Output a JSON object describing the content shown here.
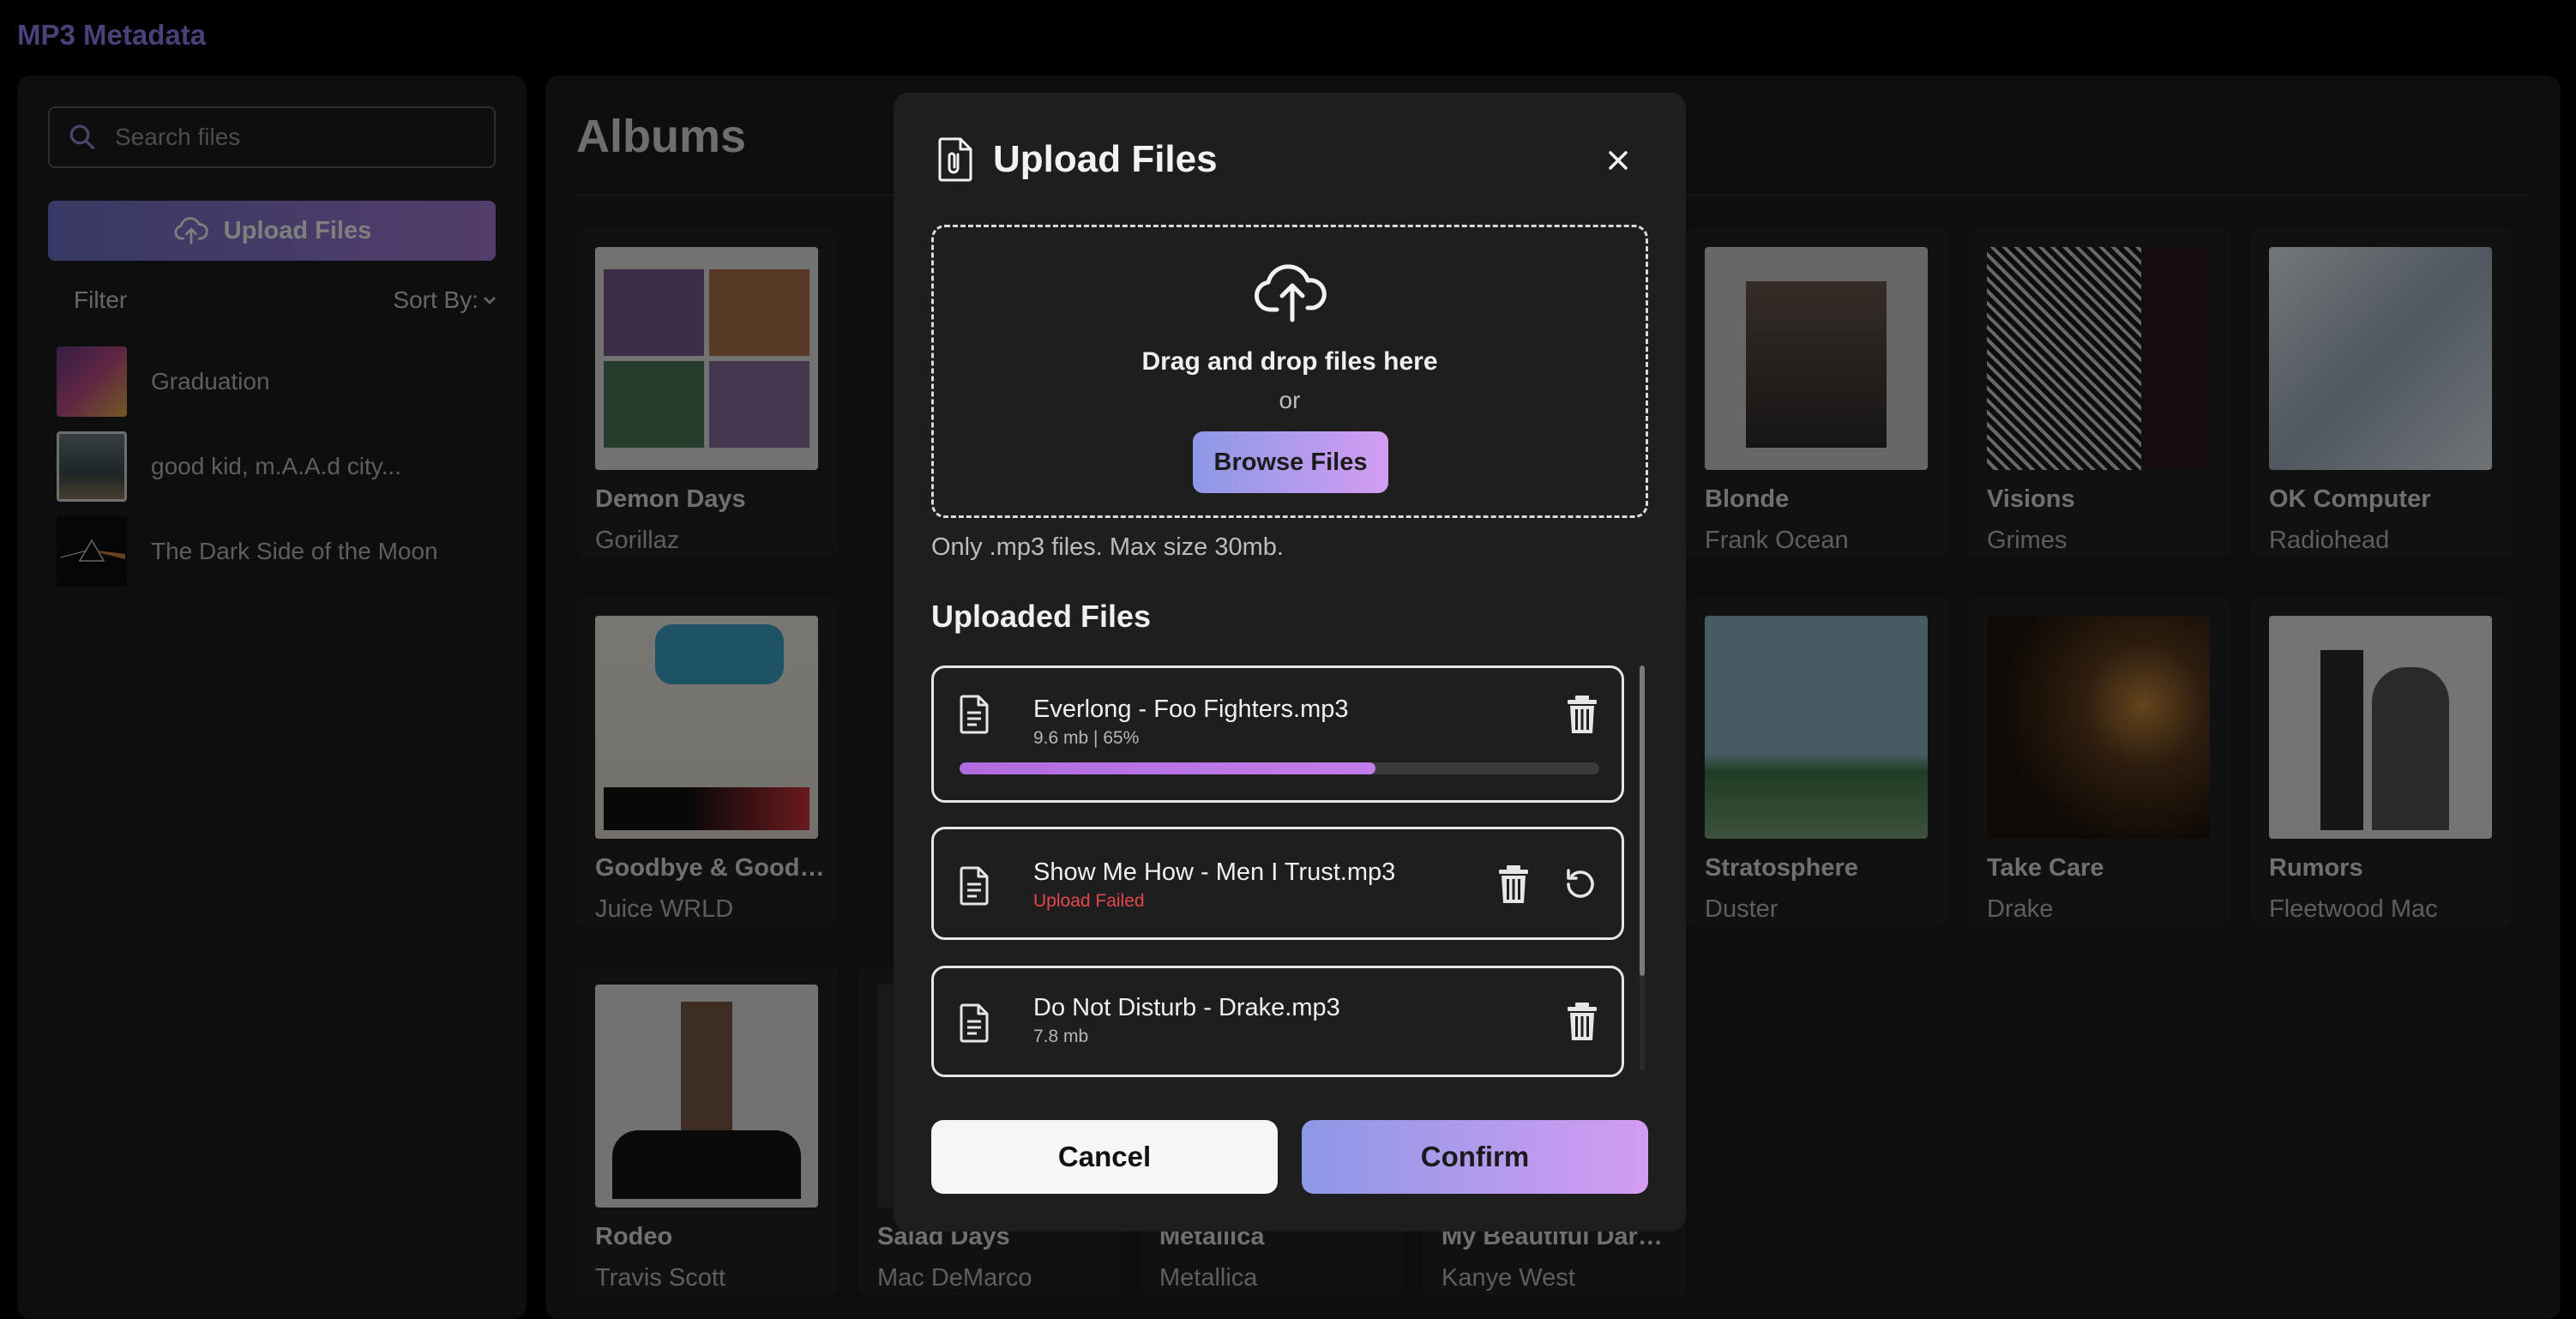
{
  "app": {
    "title": "MP3 Metadata"
  },
  "sidebar": {
    "search_placeholder": "Search files",
    "upload_label": "Upload Files",
    "filter_label": "Filter",
    "sort_label": "Sort By:",
    "items": [
      {
        "label": "Graduation"
      },
      {
        "label": "good kid, m.A.A.d city..."
      },
      {
        "label": "The Dark Side of the Moon"
      }
    ]
  },
  "main": {
    "title": "Albums",
    "albums": [
      {
        "name": "Demon Days",
        "artist": "Gorillaz"
      },
      {
        "name": "Blonde",
        "artist": "Frank Ocean"
      },
      {
        "name": "Visions",
        "artist": "Grimes"
      },
      {
        "name": "OK Computer",
        "artist": "Radiohead"
      },
      {
        "name": "Goodbye & Good Riddance",
        "artist": "Juice WRLD"
      },
      {
        "name": "Stratosphere",
        "artist": "Duster"
      },
      {
        "name": "Take Care",
        "artist": "Drake"
      },
      {
        "name": "Rumors",
        "artist": "Fleetwood Mac"
      },
      {
        "name": "Rodeo",
        "artist": "Travis Scott"
      },
      {
        "name": "Salad Days",
        "artist": "Mac DeMarco"
      },
      {
        "name": "Metallica",
        "artist": "Metallica"
      },
      {
        "name": "My Beautiful Dark Twisted Fantasy",
        "artist": "Kanye West"
      }
    ]
  },
  "modal": {
    "title": "Upload Files",
    "dropzone_main": "Drag and drop files here",
    "dropzone_or": "or",
    "browse_label": "Browse Files",
    "hint": "Only .mp3 files. Max size 30mb.",
    "uploaded_title": "Uploaded Files",
    "files": [
      {
        "name": "Everlong - Foo Fighters.mp3",
        "meta": "9.6 mb | 65%",
        "progress": 0.65
      },
      {
        "name": "Show Me How - Men I Trust.mp3",
        "meta": "Upload Failed"
      },
      {
        "name": "Do Not Disturb - Drake.mp3",
        "meta": "7.8 mb"
      }
    ],
    "cancel_label": "Cancel",
    "confirm_label": "Confirm"
  },
  "colors": {
    "accent": "#9b7ef0",
    "gradient_start": "#8d98e6",
    "gradient_end": "#d39cf2",
    "error": "#e2474a"
  },
  "icons": [
    "search-icon",
    "cloud-upload-icon",
    "chevron-down-icon",
    "paperclip-document-icon",
    "close-icon",
    "document-icon",
    "trash-icon",
    "retry-icon"
  ]
}
